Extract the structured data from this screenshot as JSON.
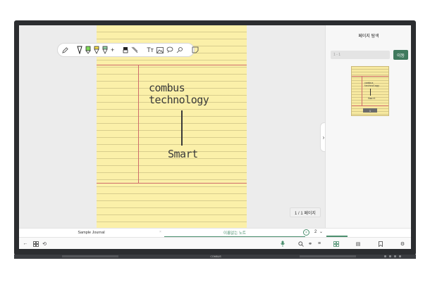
{
  "device": {
    "brand": "COMBUS"
  },
  "canvas": {
    "handwriting": {
      "line1": "combus",
      "line2": "technology",
      "line3": "Smart"
    },
    "page_indicator": "1 / 1 페이지"
  },
  "toolbar": {
    "tools": [
      "pencil-icon",
      "pen-icon",
      "highlighter-green-icon",
      "pen-yellow-icon",
      "pen-green-icon",
      "add-icon",
      "eraser-icon",
      "lasso-icon",
      "text-icon",
      "image-icon",
      "shape-icon",
      "link-icon",
      "sticky-note-icon"
    ],
    "add_label": "+",
    "text_label": "Tт"
  },
  "right_panel": {
    "title": "페이지 탐색",
    "input_placeholder": "1 - 1",
    "go_button": "이동",
    "thumbnail": {
      "text1": "combus",
      "text2": "technology",
      "text3": "Smart",
      "page_number": "1"
    }
  },
  "tabs": [
    {
      "label": "Sample Journal"
    },
    {
      "label": "이름없는 노트"
    }
  ],
  "tab_count": "2",
  "bottom_bar": {
    "left_icons": [
      "back-icon",
      "grid-icon",
      "refresh-icon"
    ],
    "center_icons": [
      "microphone-icon",
      "search-icon",
      "link-icon",
      "layout-icon"
    ],
    "right_icons": [
      "thumbnail-view-icon",
      "list-view-icon",
      "bookmark-icon",
      "settings-icon"
    ]
  },
  "colors": {
    "accent": "#3f7a5d",
    "paper": "#fbf0a9",
    "frame": "#2b2d30"
  }
}
